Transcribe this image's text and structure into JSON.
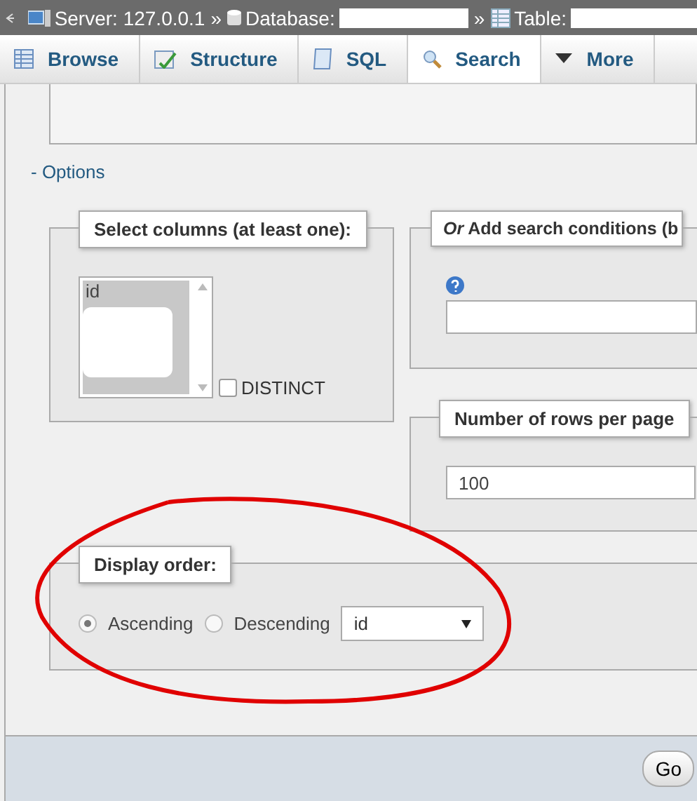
{
  "breadcrumb": [
    {
      "kind": "server",
      "text": "Server: 127.0.0.1"
    },
    {
      "kind": "separator",
      "text": "»"
    },
    {
      "kind": "database",
      "text": "Database:",
      "redacted": true
    },
    {
      "kind": "separator",
      "text": "»"
    },
    {
      "kind": "table",
      "text": "Table:",
      "redacted": true
    }
  ],
  "tabs": [
    {
      "label": "Browse",
      "kind": "browse",
      "selected": false
    },
    {
      "label": "Structure",
      "kind": "structure",
      "selected": false
    },
    {
      "label": "SQL",
      "kind": "sql",
      "selected": false
    },
    {
      "label": "Search",
      "kind": "search",
      "selected": true
    },
    {
      "label": "More",
      "kind": "more",
      "selected": false
    }
  ],
  "options_toggle": "- Options",
  "select_columns": {
    "legend": "Select columns (at least one):",
    "items": [
      "id"
    ],
    "redacted": true,
    "distinct": {
      "label": "DISTINCT",
      "checked": false
    }
  },
  "search_conditions": {
    "legend": "*Or* Add search conditions (b"
  },
  "rows_per_page": {
    "legend": "Number of rows per page",
    "value": "100"
  },
  "display_order": {
    "legend": "Display order:",
    "options": [
      {
        "label": "Ascending",
        "selected": true
      },
      {
        "label": "Descending",
        "selected": false
      }
    ],
    "column": "id"
  },
  "footer": {
    "go": "Go"
  }
}
